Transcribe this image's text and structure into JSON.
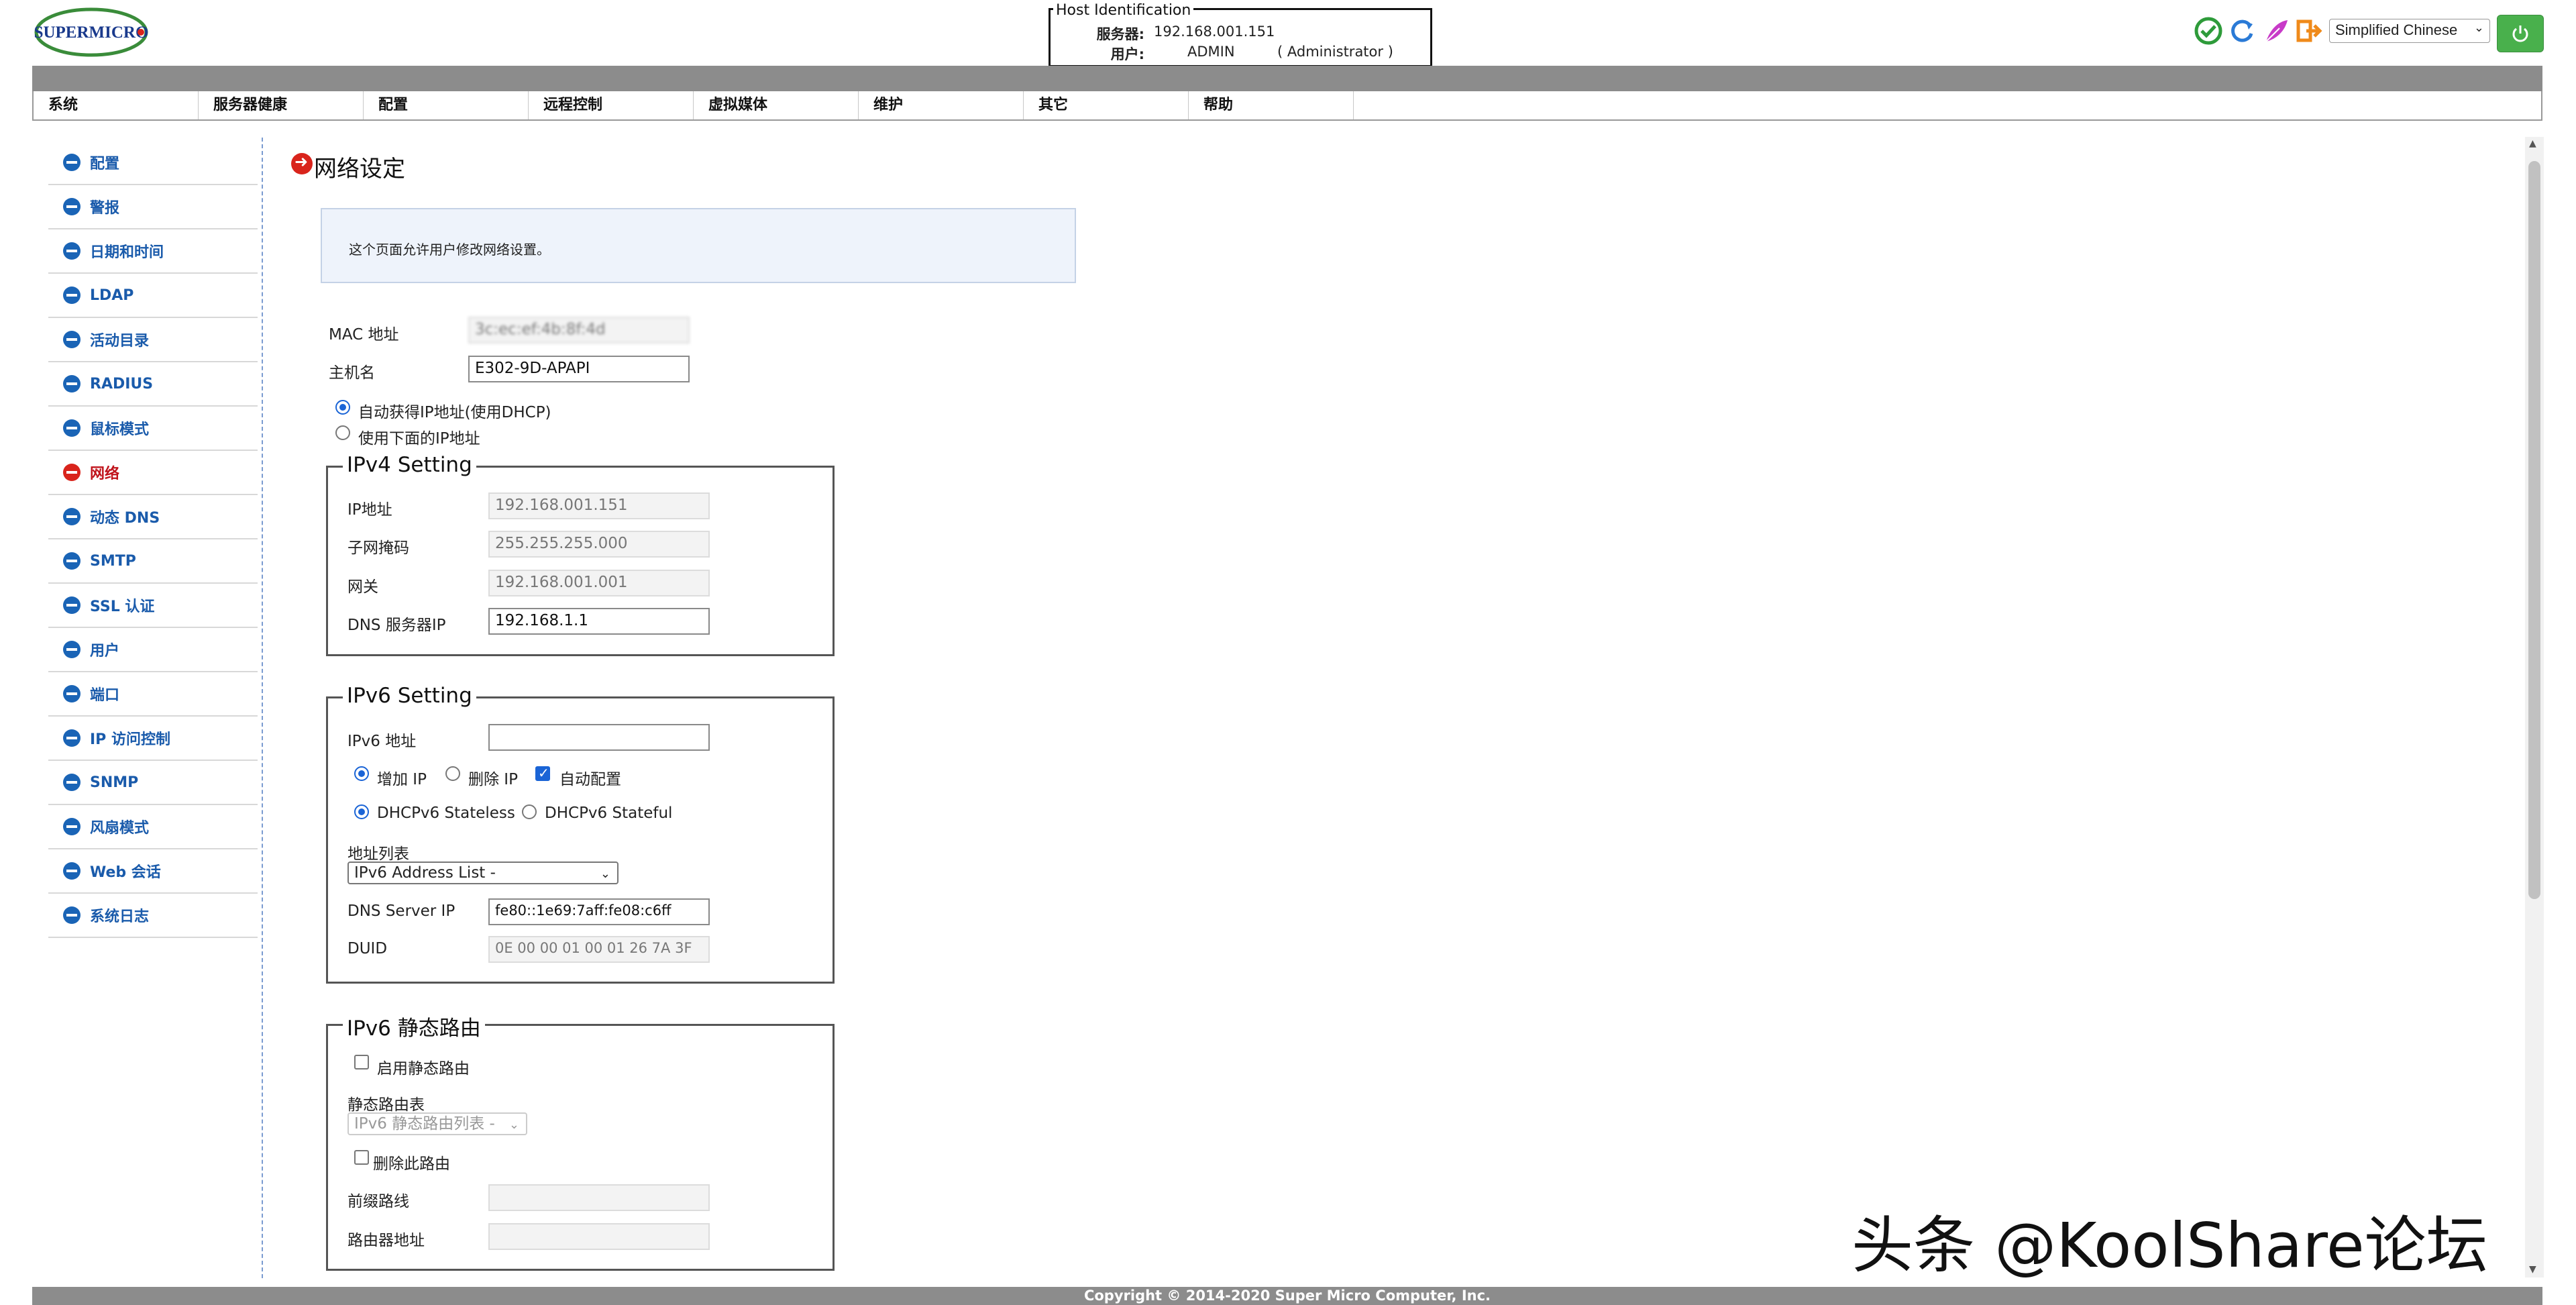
{
  "header": {
    "logo_text": "SUPERMICRO",
    "host_legend": "Host Identification",
    "server_label": "服务器:",
    "server_value": "192.168.001.151",
    "user_label": "用户:",
    "user_value": "ADMIN",
    "role_value": "( Administrator )",
    "language": "Simplified Chinese",
    "icons": [
      "check-circle-icon",
      "refresh-icon",
      "feather-icon",
      "logout-icon",
      "power-icon"
    ]
  },
  "menu": [
    "系统",
    "服务器健康",
    "配置",
    "远程控制",
    "虚拟媒体",
    "维护",
    "其它",
    "帮助"
  ],
  "sidebar": {
    "items": [
      "配置",
      "警报",
      "日期和时间",
      "LDAP",
      "活动目录",
      "RADIUS",
      "鼠标模式",
      "网络",
      "动态 DNS",
      "SMTP",
      "SSL 认证",
      "用户",
      "端口",
      "IP 访问控制",
      "SNMP",
      "风扇模式",
      "Web 会话",
      "系统日志"
    ],
    "active_index": 7
  },
  "page": {
    "title": "网络设定",
    "description": "这个页面允许用户修改网络设置。",
    "mac_label": "MAC 地址",
    "mac_value": "3c:ec:ef:4b:8f:4d",
    "hostname_label": "主机名",
    "hostname_value": "E302-9D-APAPI",
    "dhcp_option": "自动获得IP地址(使用DHCP)",
    "static_option": "使用下面的IP地址"
  },
  "ipv4": {
    "legend": "IPv4 Setting",
    "ip_label": "IP地址",
    "ip_value": "192.168.001.151",
    "mask_label": "子网掩码",
    "mask_value": "255.255.255.000",
    "gateway_label": "网关",
    "gateway_value": "192.168.001.001",
    "dns_label": "DNS 服务器IP",
    "dns_value": "192.168.1.1"
  },
  "ipv6": {
    "legend": "IPv6 Setting",
    "addr_label": "IPv6 地址",
    "addr_value": "",
    "add_ip": "增加 IP",
    "del_ip": "删除 IP",
    "autoconf": "自动配置",
    "stateless": "DHCPv6 Stateless",
    "stateful": "DHCPv6 Stateful",
    "list_label": "地址列表",
    "list_value": "IPv6 Address List -",
    "dns_label": "DNS Server IP",
    "dns_value": "fe80::1e69:7aff:fe08:c6ff",
    "duid_label": "DUID",
    "duid_value": "0E 00 00 01 00 01 26 7A 3F"
  },
  "route": {
    "legend": "IPv6 静态路由",
    "enable_label": "启用静态路由",
    "table_label": "静态路由表",
    "table_value": "IPv6 静态路由列表 -",
    "delete_label": "删除此路由",
    "prefix_label": "前缀路线",
    "prefix_value": "",
    "router_label": "路由器地址",
    "router_value": ""
  },
  "footer": "Copyright © 2014-2020 Super Micro Computer, Inc.",
  "watermark": "头条 @KoolShare论坛",
  "colors": {
    "menu_band": "#8c8c8c",
    "sidebar_link": "#1a5bab",
    "active": "#d9241c",
    "power": "#49b04c"
  }
}
